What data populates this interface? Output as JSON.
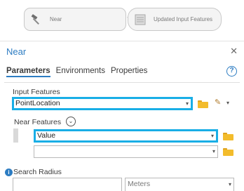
{
  "diagram": {
    "tool_node": {
      "label": "Near",
      "icon": "hammer-icon"
    },
    "output_node": {
      "label": "Updated Input Features",
      "icon": "feature-layer-icon"
    }
  },
  "pane": {
    "title": "Near",
    "close_icon": "close-icon",
    "tabs": [
      {
        "label": "Parameters",
        "active": true
      },
      {
        "label": "Environments",
        "active": false
      },
      {
        "label": "Properties",
        "active": false
      }
    ],
    "help_glyph": "?",
    "input_features": {
      "label": "Input Features",
      "value": "PointLocation"
    },
    "near_features": {
      "label": "Near Features",
      "rows": [
        {
          "value": "Value"
        },
        {
          "value": ""
        }
      ]
    },
    "search_radius": {
      "label": "Search Radius",
      "value": "",
      "unit": "Meters"
    }
  },
  "colors": {
    "accent": "#2c7cc2",
    "highlight": "#19aee6",
    "folder": "#f3bc2c"
  }
}
